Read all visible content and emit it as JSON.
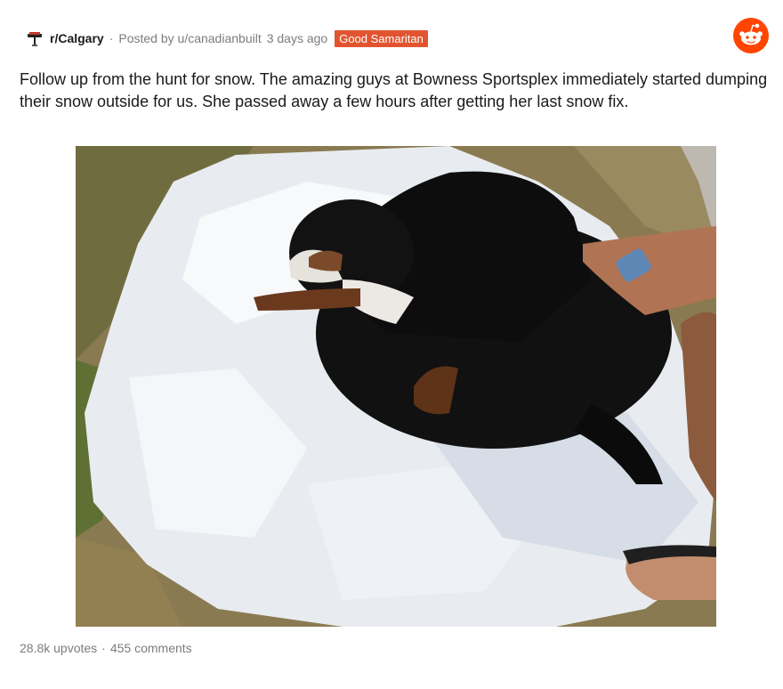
{
  "post": {
    "subreddit": "r/Calgary",
    "separator": "·",
    "posted_by": "Posted by u/canadianbuilt",
    "age": "3 days ago",
    "award": "Good Samaritan",
    "title": "Follow up from the hunt for snow. The amazing guys at Bowness Sportsplex immediately started dumping their snow outside for us. She passed away a few hours after getting her last snow fix.",
    "image_icon": "dog-on-snow-photo"
  },
  "footer": {
    "upvotes": "28.8k upvotes",
    "separator": "·",
    "comments": "455 comments"
  },
  "icons": {
    "subreddit": "calgary-tower-icon",
    "brand": "reddit-alien-icon"
  },
  "colors": {
    "award_bg": "#e1542f",
    "reddit_orange": "#ff4500",
    "meta_text": "#7c7c7c"
  }
}
